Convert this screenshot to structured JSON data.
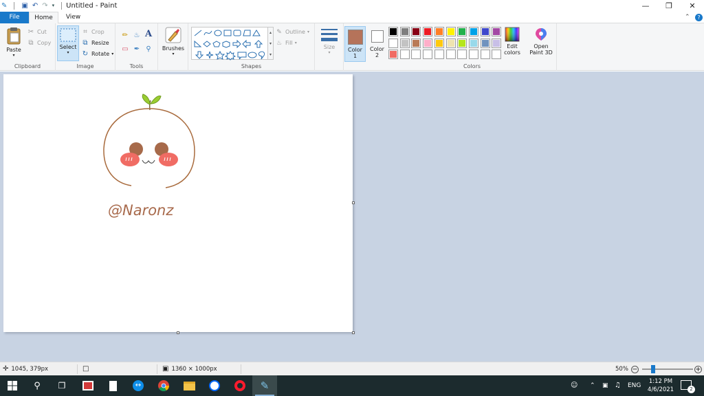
{
  "window": {
    "title": "Untitled - Paint",
    "controls": [
      "minimize",
      "restore",
      "close"
    ]
  },
  "tabs": [
    {
      "label": "File"
    },
    {
      "label": "Home"
    },
    {
      "label": "View"
    }
  ],
  "ribbon": {
    "clipboard": {
      "label": "Clipboard",
      "paste": "Paste",
      "cut": "Cut",
      "copy": "Copy"
    },
    "image": {
      "label": "Image",
      "select": "Select",
      "crop": "Crop",
      "resize": "Resize",
      "rotate": "Rotate"
    },
    "tools": {
      "label": "Tools",
      "text_glyph": "A"
    },
    "brushes": {
      "label": "Brushes"
    },
    "shapes": {
      "label": "Shapes",
      "outline": "Outline",
      "fill": "Fill"
    },
    "size": {
      "label": "Size"
    },
    "color1": {
      "label": "Color",
      "sub": "1",
      "value": "#b5735a"
    },
    "color2": {
      "label": "Color",
      "sub": "2",
      "value": "#ffffff"
    },
    "colors": {
      "label": "Colors",
      "row1": [
        "#000000",
        "#7f7f7f",
        "#880015",
        "#ed1c24",
        "#ff7f27",
        "#fff200",
        "#22b14c",
        "#00a2e8",
        "#3f48cc",
        "#a349a4"
      ],
      "row2": [
        "#ffffff",
        "#c3c3c3",
        "#b97a57",
        "#ffaec9",
        "#ffc90e",
        "#efe4b0",
        "#b5e61d",
        "#99d9ea",
        "#7092be",
        "#c8bfe7"
      ],
      "row3": [
        "#f06c64",
        "#ffffff",
        "#ffffff",
        "#ffffff",
        "#ffffff",
        "#ffffff",
        "#ffffff",
        "#ffffff",
        "#ffffff",
        "#ffffff"
      ]
    },
    "edit_colors": {
      "line1": "Edit",
      "line2": "colors"
    },
    "open3d": {
      "line1": "Open",
      "line2": "Paint 3D"
    }
  },
  "canvas": {
    "signature": "@Naronz"
  },
  "status": {
    "cursor_position": "1045, 379px",
    "canvas_size": "1360 × 1000px",
    "zoom": "50%",
    "zoom_level": 0.5
  },
  "taskbar": {
    "language": "ENG",
    "time": "1:12 PM",
    "date": "4/6/2021",
    "notifications": "2"
  }
}
